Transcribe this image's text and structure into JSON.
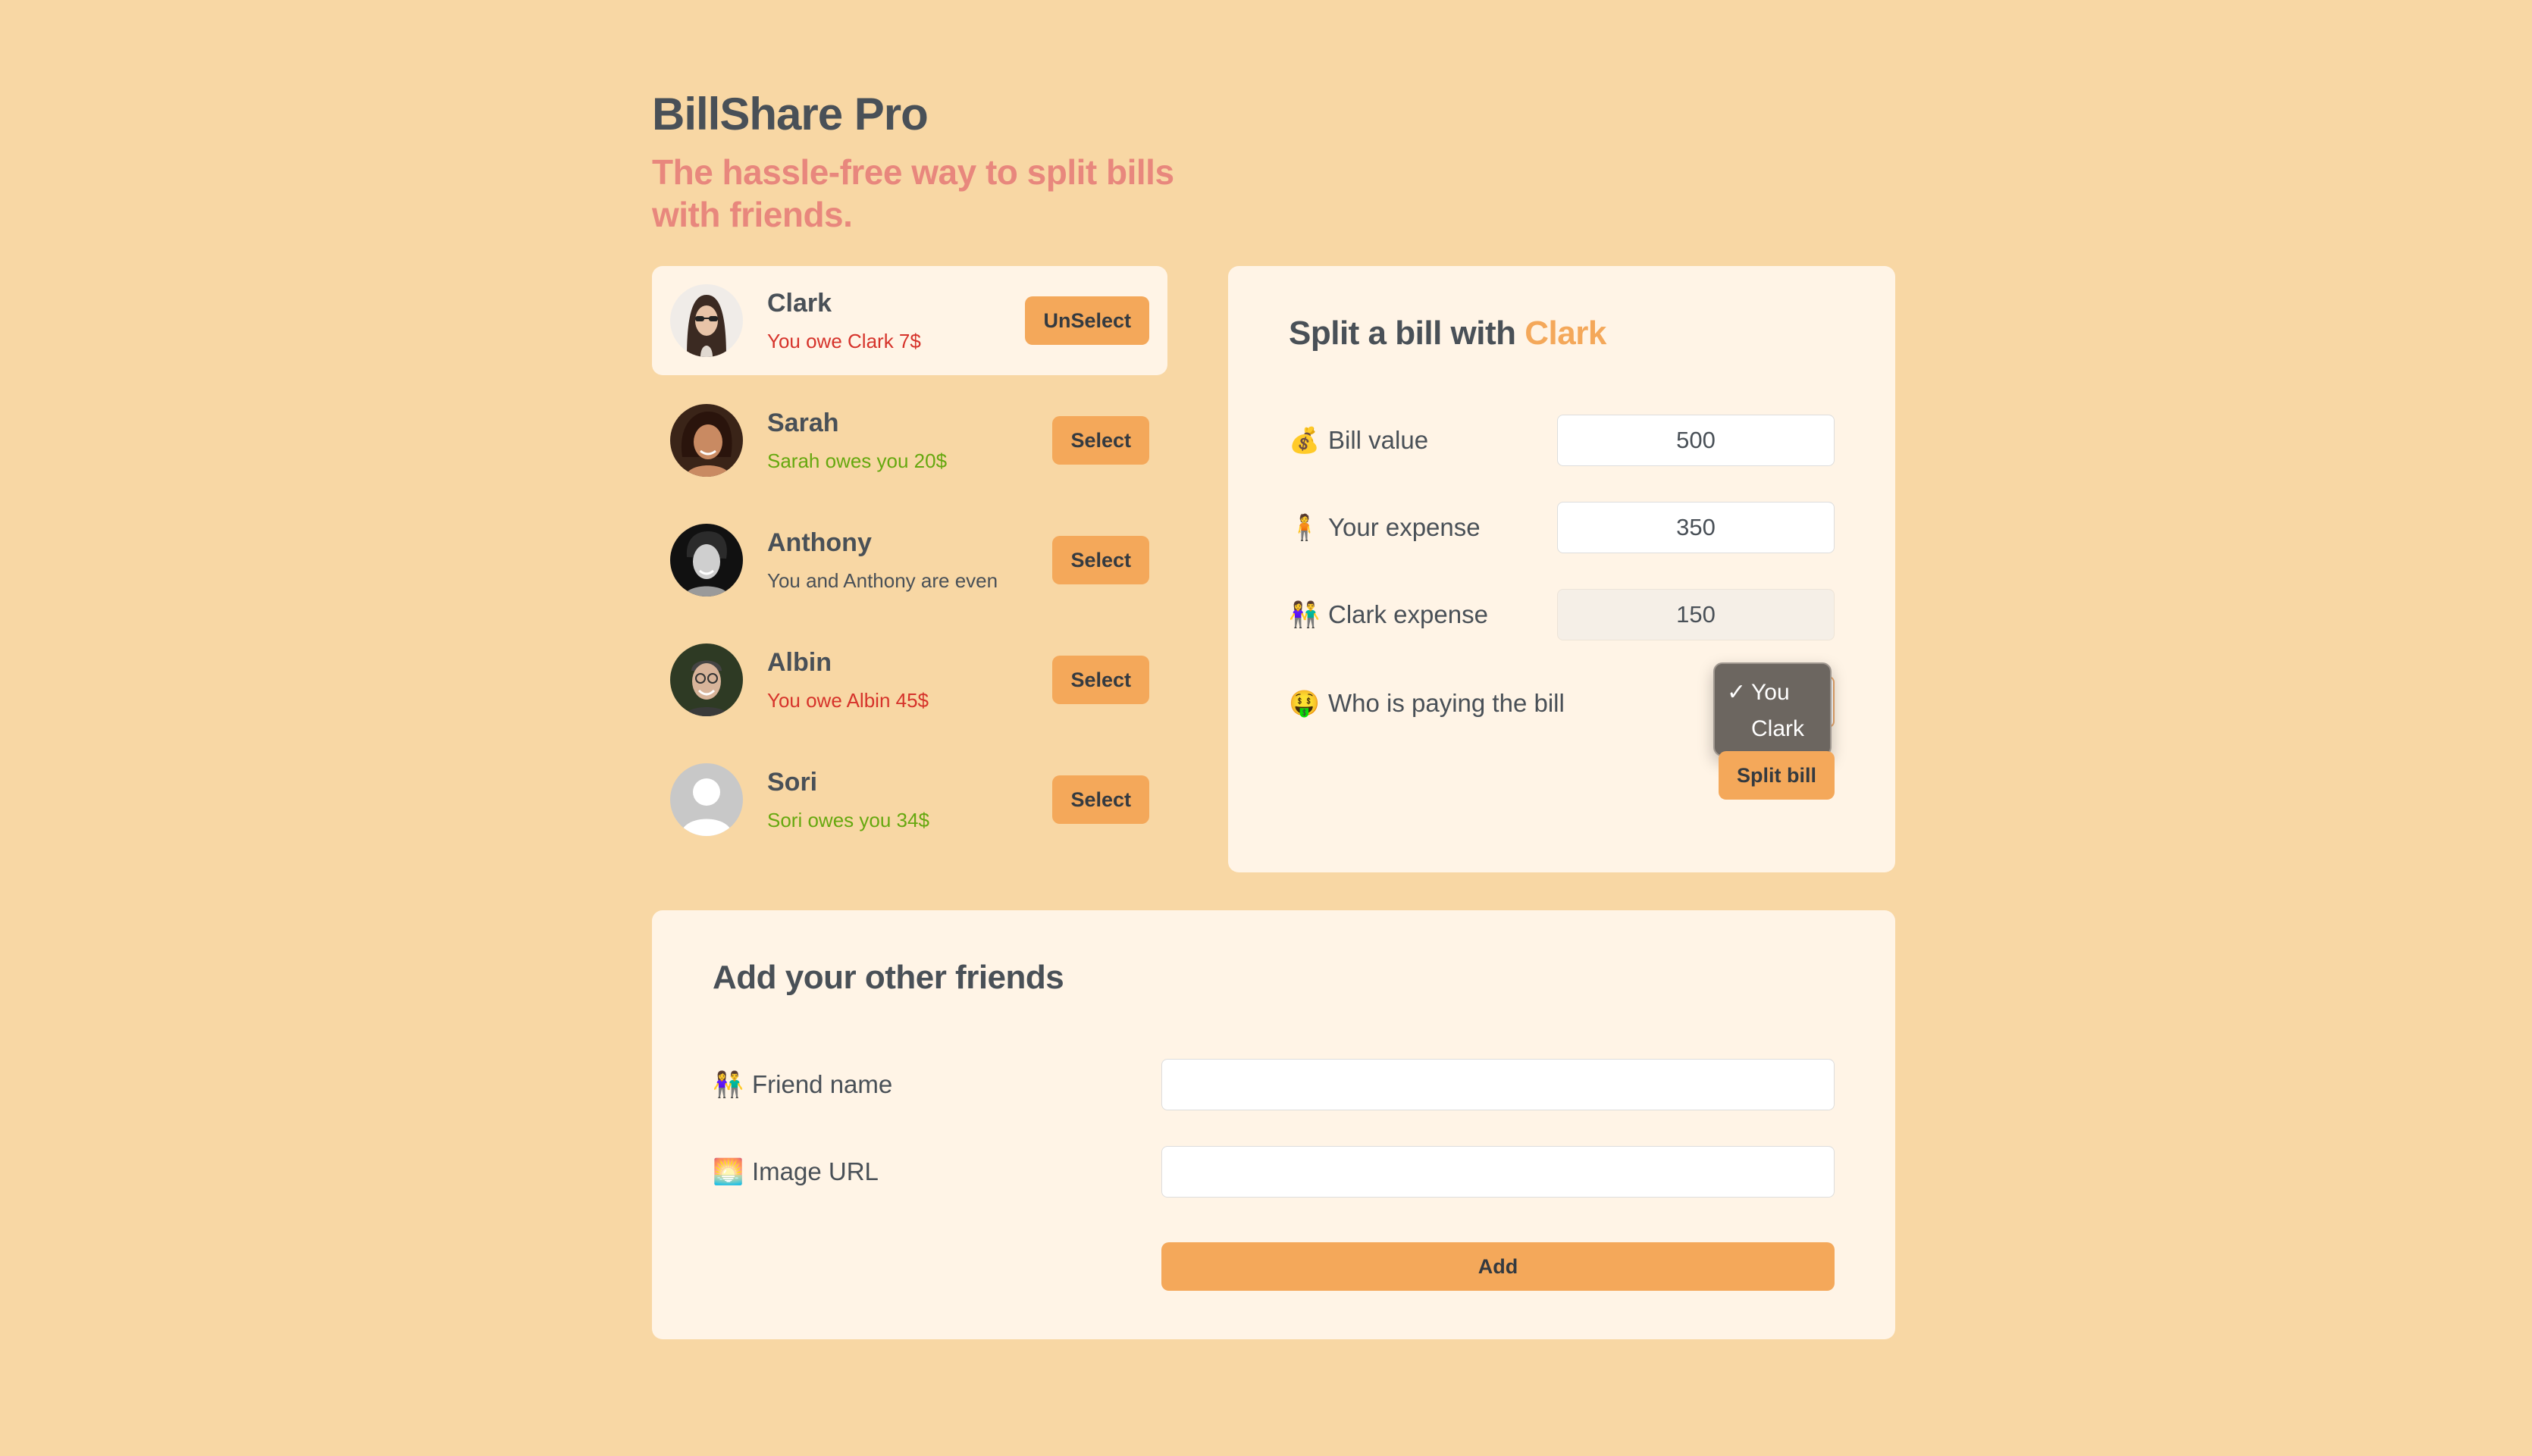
{
  "app": {
    "title": "BillShare Pro",
    "subtitle": "The hassle-free way to split bills with friends."
  },
  "colors": {
    "background": "#f8d7a4",
    "panel": "#fff4e6",
    "accent": "#f4a85a",
    "subtitle": "#e8877d",
    "owe": "#d6332b",
    "owed": "#66a80f",
    "even": "#495057"
  },
  "friends": [
    {
      "name": "Clark",
      "status": "You owe Clark 7$",
      "balance": "owe",
      "button": "UnSelect",
      "selected": true
    },
    {
      "name": "Sarah",
      "status": "Sarah owes you 20$",
      "balance": "owed",
      "button": "Select",
      "selected": false
    },
    {
      "name": "Anthony",
      "status": "You and Anthony are even",
      "balance": "even",
      "button": "Select",
      "selected": false
    },
    {
      "name": "Albin",
      "status": "You owe Albin 45$",
      "balance": "owe",
      "button": "Select",
      "selected": false
    },
    {
      "name": "Sori",
      "status": "Sori owes you 34$",
      "balance": "owed",
      "button": "Select",
      "selected": false
    }
  ],
  "split": {
    "title_prefix": "Split a bill with",
    "friend_name": "Clark",
    "bill_value_emoji": "💰",
    "bill_value_label": "Bill value",
    "bill_value": "500",
    "your_expense_emoji": "🧍",
    "your_expense_label": "Your expense",
    "your_expense": "350",
    "friend_expense_emoji": "👫",
    "friend_expense_label": "Clark expense",
    "friend_expense": "150",
    "payer_emoji": "🤑",
    "payer_label": "Who is paying the bill",
    "payer_options": [
      "You",
      "Clark"
    ],
    "payer_selected": "You",
    "check_mark": "✓",
    "submit_label": "Split bill"
  },
  "add_friend": {
    "title": "Add your other friends",
    "name_emoji": "👫",
    "name_label": "Friend name",
    "name_value": "",
    "image_emoji": "🌅",
    "image_label": "Image URL",
    "image_value": "",
    "submit_label": "Add"
  }
}
